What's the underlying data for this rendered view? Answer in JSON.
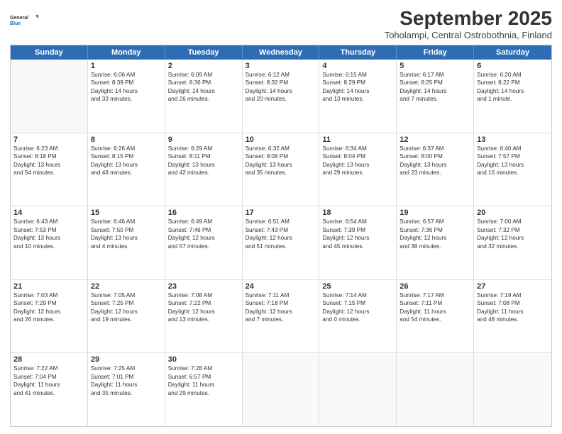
{
  "logo": {
    "line1": "General",
    "line2": "Blue"
  },
  "title": "September 2025",
  "subtitle": "Toholampi, Central Ostrobothnia, Finland",
  "header_days": [
    "Sunday",
    "Monday",
    "Tuesday",
    "Wednesday",
    "Thursday",
    "Friday",
    "Saturday"
  ],
  "weeks": [
    [
      {
        "day": "",
        "info": ""
      },
      {
        "day": "1",
        "info": "Sunrise: 6:06 AM\nSunset: 8:39 PM\nDaylight: 14 hours\nand 33 minutes."
      },
      {
        "day": "2",
        "info": "Sunrise: 6:09 AM\nSunset: 8:36 PM\nDaylight: 14 hours\nand 26 minutes."
      },
      {
        "day": "3",
        "info": "Sunrise: 6:12 AM\nSunset: 8:32 PM\nDaylight: 14 hours\nand 20 minutes."
      },
      {
        "day": "4",
        "info": "Sunrise: 6:15 AM\nSunset: 8:29 PM\nDaylight: 14 hours\nand 13 minutes."
      },
      {
        "day": "5",
        "info": "Sunrise: 6:17 AM\nSunset: 8:25 PM\nDaylight: 14 hours\nand 7 minutes."
      },
      {
        "day": "6",
        "info": "Sunrise: 6:20 AM\nSunset: 8:22 PM\nDaylight: 14 hours\nand 1 minute."
      }
    ],
    [
      {
        "day": "7",
        "info": "Sunrise: 6:23 AM\nSunset: 8:18 PM\nDaylight: 13 hours\nand 54 minutes."
      },
      {
        "day": "8",
        "info": "Sunrise: 6:26 AM\nSunset: 8:15 PM\nDaylight: 13 hours\nand 48 minutes."
      },
      {
        "day": "9",
        "info": "Sunrise: 6:29 AM\nSunset: 8:11 PM\nDaylight: 13 hours\nand 42 minutes."
      },
      {
        "day": "10",
        "info": "Sunrise: 6:32 AM\nSunset: 8:08 PM\nDaylight: 13 hours\nand 35 minutes."
      },
      {
        "day": "11",
        "info": "Sunrise: 6:34 AM\nSunset: 8:04 PM\nDaylight: 13 hours\nand 29 minutes."
      },
      {
        "day": "12",
        "info": "Sunrise: 6:37 AM\nSunset: 8:00 PM\nDaylight: 13 hours\nand 23 minutes."
      },
      {
        "day": "13",
        "info": "Sunrise: 6:40 AM\nSunset: 7:57 PM\nDaylight: 13 hours\nand 16 minutes."
      }
    ],
    [
      {
        "day": "14",
        "info": "Sunrise: 6:43 AM\nSunset: 7:53 PM\nDaylight: 13 hours\nand 10 minutes."
      },
      {
        "day": "15",
        "info": "Sunrise: 6:46 AM\nSunset: 7:50 PM\nDaylight: 13 hours\nand 4 minutes."
      },
      {
        "day": "16",
        "info": "Sunrise: 6:49 AM\nSunset: 7:46 PM\nDaylight: 12 hours\nand 57 minutes."
      },
      {
        "day": "17",
        "info": "Sunrise: 6:51 AM\nSunset: 7:43 PM\nDaylight: 12 hours\nand 51 minutes."
      },
      {
        "day": "18",
        "info": "Sunrise: 6:54 AM\nSunset: 7:39 PM\nDaylight: 12 hours\nand 45 minutes."
      },
      {
        "day": "19",
        "info": "Sunrise: 6:57 AM\nSunset: 7:36 PM\nDaylight: 12 hours\nand 38 minutes."
      },
      {
        "day": "20",
        "info": "Sunrise: 7:00 AM\nSunset: 7:32 PM\nDaylight: 12 hours\nand 32 minutes."
      }
    ],
    [
      {
        "day": "21",
        "info": "Sunrise: 7:03 AM\nSunset: 7:29 PM\nDaylight: 12 hours\nand 26 minutes."
      },
      {
        "day": "22",
        "info": "Sunrise: 7:05 AM\nSunset: 7:25 PM\nDaylight: 12 hours\nand 19 minutes."
      },
      {
        "day": "23",
        "info": "Sunrise: 7:08 AM\nSunset: 7:22 PM\nDaylight: 12 hours\nand 13 minutes."
      },
      {
        "day": "24",
        "info": "Sunrise: 7:11 AM\nSunset: 7:18 PM\nDaylight: 12 hours\nand 7 minutes."
      },
      {
        "day": "25",
        "info": "Sunrise: 7:14 AM\nSunset: 7:15 PM\nDaylight: 12 hours\nand 0 minutes."
      },
      {
        "day": "26",
        "info": "Sunrise: 7:17 AM\nSunset: 7:11 PM\nDaylight: 11 hours\nand 54 minutes."
      },
      {
        "day": "27",
        "info": "Sunrise: 7:19 AM\nSunset: 7:08 PM\nDaylight: 11 hours\nand 48 minutes."
      }
    ],
    [
      {
        "day": "28",
        "info": "Sunrise: 7:22 AM\nSunset: 7:04 PM\nDaylight: 11 hours\nand 41 minutes."
      },
      {
        "day": "29",
        "info": "Sunrise: 7:25 AM\nSunset: 7:01 PM\nDaylight: 11 hours\nand 35 minutes."
      },
      {
        "day": "30",
        "info": "Sunrise: 7:28 AM\nSunset: 6:57 PM\nDaylight: 11 hours\nand 29 minutes."
      },
      {
        "day": "",
        "info": ""
      },
      {
        "day": "",
        "info": ""
      },
      {
        "day": "",
        "info": ""
      },
      {
        "day": "",
        "info": ""
      }
    ]
  ]
}
